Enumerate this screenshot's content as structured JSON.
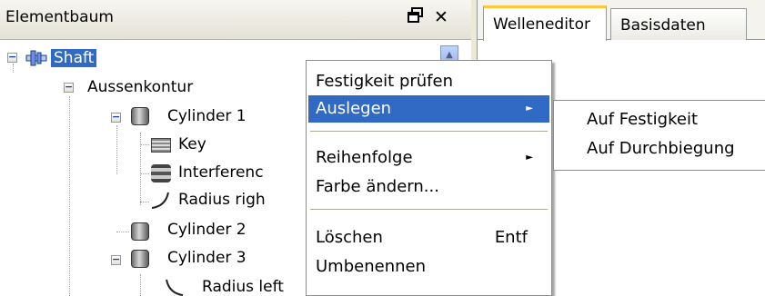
{
  "element_tree_panel": {
    "title": "Elementbaum",
    "pin_icon": "pin-icon",
    "close_icon": "✕",
    "nodes": [
      {
        "label": "Shaft",
        "icon": "shaft-icon",
        "selected": true
      },
      {
        "label": "Aussenkontur",
        "icon": null
      },
      {
        "label": "Cylinder 1",
        "icon": "cylinder-icon"
      },
      {
        "label": "Key",
        "icon": "key-icon"
      },
      {
        "label": "Interferenc",
        "icon": "interference-icon"
      },
      {
        "label": "Radius righ",
        "icon": "radius-icon"
      },
      {
        "label": "Cylinder 2",
        "icon": "cylinder-icon"
      },
      {
        "label": "Cylinder 3",
        "icon": "cylinder-icon"
      },
      {
        "label": "Radius left",
        "icon": "radius-icon"
      }
    ]
  },
  "tabs": [
    {
      "label": "Welleneditor",
      "active": true
    },
    {
      "label": "Basisdaten",
      "active": false
    }
  ],
  "context_menu": {
    "items": [
      {
        "label": "Festigkeit prüfen"
      },
      {
        "label": "Auslegen",
        "submenu": true,
        "highlighted": true
      },
      {
        "label": "Reihenfolge",
        "submenu": true
      },
      {
        "label": "Farbe ändern..."
      },
      {
        "label": "Löschen",
        "shortcut": "Entf"
      },
      {
        "label": "Umbenennen"
      }
    ]
  },
  "submenu": {
    "items": [
      {
        "label": "Auf Festigkeit"
      },
      {
        "label": "Auf Durchbiegung"
      }
    ]
  },
  "colors": {
    "selection": "#316ac5",
    "tab_accent": "#ffc83c",
    "window_bg": "#ece9d8"
  }
}
